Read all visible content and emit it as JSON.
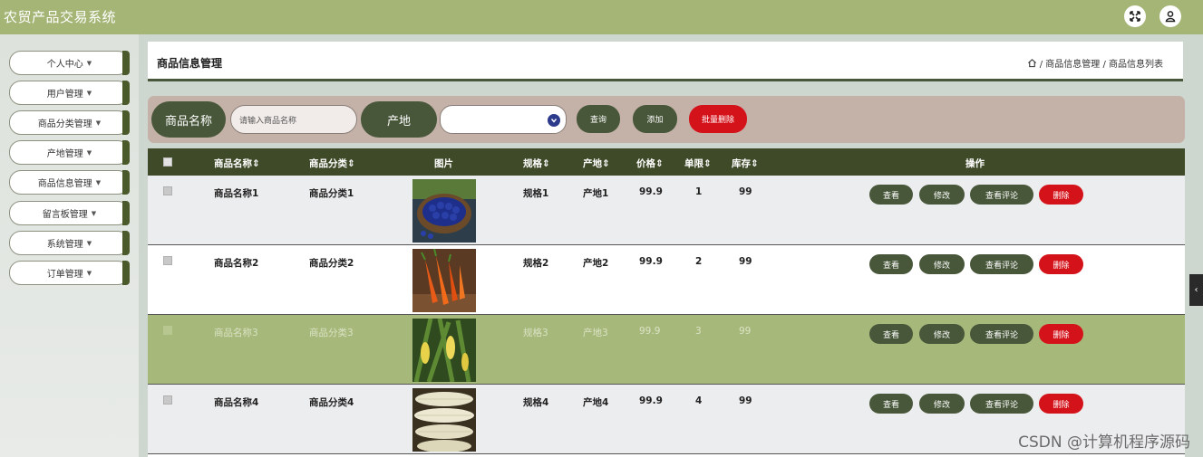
{
  "app": {
    "title": "农贸产品交易系统"
  },
  "topbar": {
    "icons": [
      "fullscreen-icon",
      "user-icon"
    ]
  },
  "sidebar": {
    "items": [
      {
        "label": "个人中心"
      },
      {
        "label": "用户管理"
      },
      {
        "label": "商品分类管理"
      },
      {
        "label": "产地管理"
      },
      {
        "label": "商品信息管理"
      },
      {
        "label": "留言板管理"
      },
      {
        "label": "系统管理"
      },
      {
        "label": "订单管理"
      }
    ],
    "caret": "▼"
  },
  "header": {
    "title": "商品信息管理",
    "breadcrumb": " / 商品信息管理 / 商品信息列表"
  },
  "search": {
    "name_label": "商品名称",
    "name_placeholder": "请输入商品名称",
    "origin_label": "产地",
    "origin_value": "",
    "query_button": "查询",
    "add_button": "添加",
    "batch_delete_button": "批量删除"
  },
  "table": {
    "columns": [
      "商品名称⇕",
      "商品分类⇕",
      "图片",
      "规格⇕",
      "产地⇕",
      "价格⇕",
      "单限⇕",
      "库存⇕",
      "操作"
    ],
    "rows": [
      {
        "name": "商品名称1",
        "category": "商品分类1",
        "spec": "规格1",
        "origin": "产地1",
        "price": "99.9",
        "limit": "1",
        "stock": "99",
        "image": "blueberry"
      },
      {
        "name": "商品名称2",
        "category": "商品分类2",
        "spec": "规格2",
        "origin": "产地2",
        "price": "99.9",
        "limit": "2",
        "stock": "99",
        "image": "carrot"
      },
      {
        "name": "商品名称3",
        "category": "商品分类3",
        "spec": "规格3",
        "origin": "产地3",
        "price": "99.9",
        "limit": "3",
        "stock": "99",
        "image": "corn-field"
      },
      {
        "name": "商品名称4",
        "category": "商品分类4",
        "spec": "规格4",
        "origin": "产地4",
        "price": "99.9",
        "limit": "4",
        "stock": "99",
        "image": "corn-cobs"
      }
    ],
    "actions": {
      "view": "查看",
      "edit": "修改",
      "comments": "查看评论",
      "delete": "删除"
    }
  },
  "watermark": "CSDN @计算机程序源码",
  "colors": {
    "topbar": "#a4b576",
    "dark_green": "#48573a",
    "red": "#d4121a",
    "highlight_row": "#a7b97a"
  }
}
